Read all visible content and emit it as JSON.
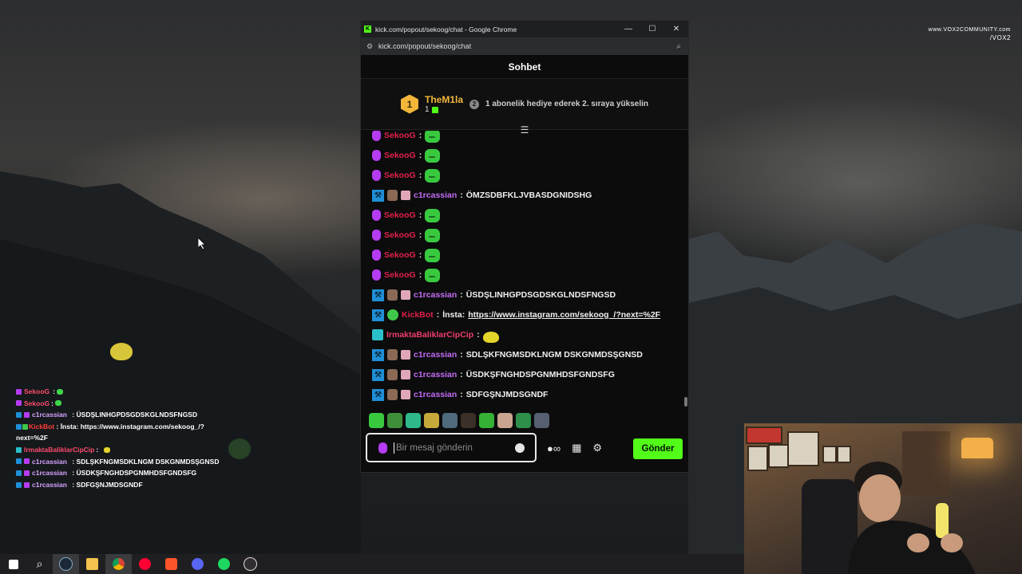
{
  "watermark": {
    "line1": "www.VOX2COMMUNITY.com",
    "line2": "/VOX2"
  },
  "overlay_chat": [
    {
      "user": "SekooG",
      "text": ""
    },
    {
      "user": "SekooG",
      "text": ""
    },
    {
      "user": "c1rcassian",
      "text": ": ÜSDŞLINHGPDSGDSKGLNDSFNGSD"
    },
    {
      "user": "KickBot",
      "text": ": İnsta: https://www.instagram.com/sekoog_/?next=%2F"
    },
    {
      "user": "IrmaktaBaliklarCipCip",
      "text": ":"
    },
    {
      "user": "c1rcassian",
      "text": ": SDLŞKFNGMSDKLNGM DSKGNMDSŞGNSD"
    },
    {
      "user": "c1rcassian",
      "text": ": ÜSDKŞFNGHDSPGNMHDSFGNDSFG"
    },
    {
      "user": "c1rcassian",
      "text": ": SDFGŞNJMDSGNDF"
    }
  ],
  "browser": {
    "title": "kick.com/popout/sekoog/chat - Google Chrome",
    "url": "kick.com/popout/sekoog/chat",
    "minimize": "—",
    "maximize": "☐",
    "close": "✕"
  },
  "chat": {
    "header": "Sohbet",
    "top_gifter": {
      "rank": "1",
      "name": "TheM1la",
      "count": "1",
      "next_rank": "2",
      "message": "1 abonelik hediye ederek 2. sıraya yükselin"
    },
    "messages": [
      {
        "user": "SekooG",
        "sep": ":",
        "text": ""
      },
      {
        "user": "SekooG",
        "sep": ":",
        "text": ""
      },
      {
        "user": "SekooG",
        "sep": ":",
        "text": ""
      },
      {
        "user": "c1rcassian",
        "sep": ":",
        "text": "ÖMZSDBFKLJVBASDGNIDSHG"
      },
      {
        "user": "SekooG",
        "sep": ":",
        "text": ""
      },
      {
        "user": "SekooG",
        "sep": ":",
        "text": ""
      },
      {
        "user": "SekooG",
        "sep": ":",
        "text": ""
      },
      {
        "user": "SekooG",
        "sep": ":",
        "text": ""
      },
      {
        "user": "c1rcassian",
        "sep": ":",
        "text": "ÜSDŞLINHGPDSGDSKGLNDSFNGSD"
      },
      {
        "user": "KickBot",
        "sep": ":",
        "text": "İnsta:",
        "link": "https://www.instagram.com/sekoog_/?next=%2F"
      },
      {
        "user": "IrmaktaBaliklarCipCip",
        "sep": ":",
        "text": ""
      },
      {
        "user": "c1rcassian",
        "sep": ":",
        "text": "SDLŞKFNGMSDKLNGM DSKGNMDSŞGNSD"
      },
      {
        "user": "c1rcassian",
        "sep": ":",
        "text": "ÜSDKŞFNGHDSPGNMHDSFGNDSFG"
      },
      {
        "user": "c1rcassian",
        "sep": ":",
        "text": "SDFGŞNJMDSGNDF"
      }
    ],
    "input_placeholder": "Bir mesaj gönderin",
    "send_label": "Gönder"
  },
  "colors": {
    "kick_green": "#53fc18",
    "sekoog": "#e2214a",
    "c1rcassian": "#c36cf5",
    "gold": "#f2b73a"
  },
  "taskbar_icons": [
    "windows-icon",
    "search-icon",
    "steam-icon",
    "file-explorer-icon",
    "chrome-icon",
    "youtube-music-icon",
    "brave-icon",
    "discord-icon",
    "spotify-icon",
    "obs-icon"
  ]
}
